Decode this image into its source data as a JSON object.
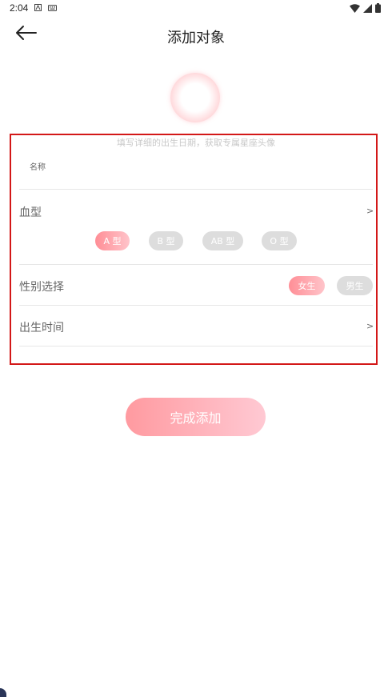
{
  "status_bar": {
    "time": "2:04"
  },
  "header": {
    "title": "添加对象",
    "back_icon": "arrow-left-icon"
  },
  "avatar": {
    "hint": "填写详细的出生日期，获取专属星座头像"
  },
  "form": {
    "name_label": "名称",
    "name_value": "",
    "blood_type": {
      "label": "血型",
      "chevron": ">",
      "options": [
        "A 型",
        "B 型",
        "AB 型",
        "O 型"
      ],
      "selected": "A 型"
    },
    "gender": {
      "label": "性别选择",
      "options": [
        "女生",
        "男生"
      ],
      "selected": "女生"
    },
    "birth_time": {
      "label": "出生时间",
      "chevron": ">"
    }
  },
  "submit": {
    "label": "完成添加"
  },
  "colors": {
    "accent": "#ff8e96",
    "inactive": "#dddddd",
    "highlight_box": "#d31818"
  }
}
